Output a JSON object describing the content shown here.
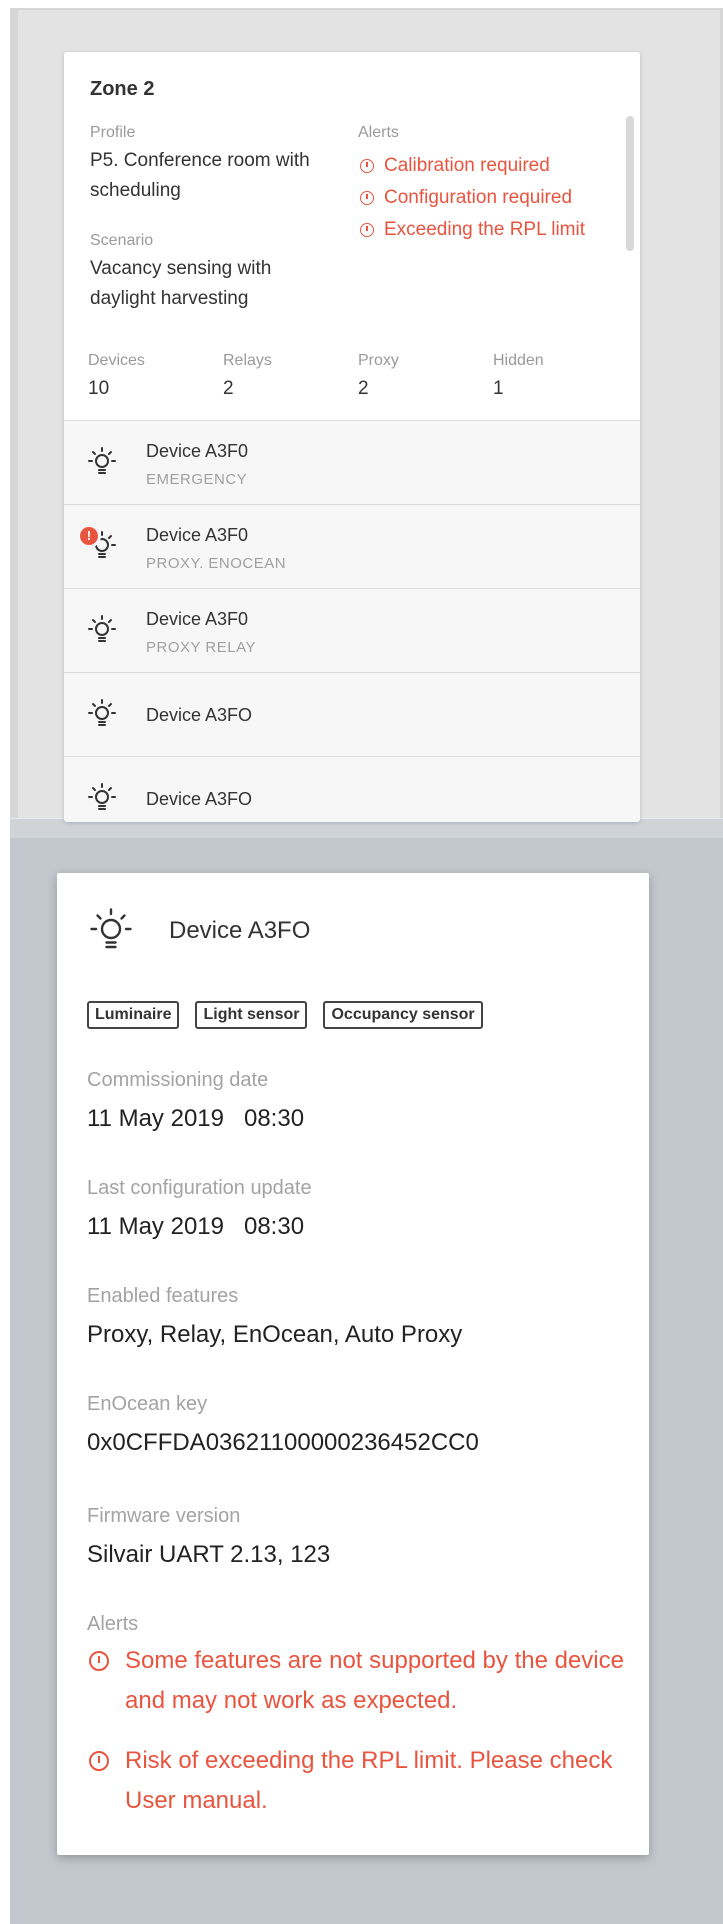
{
  "zone": {
    "title": "Zone 2",
    "profile_label": "Profile",
    "profile_value": "P5. Conference room with scheduling",
    "scenario_label": "Scenario",
    "scenario_value": "Vacancy sensing with daylight harvesting",
    "alerts_label": "Alerts",
    "alerts": [
      "Calibration required",
      "Configuration required",
      "Exceeding the RPL limit"
    ],
    "stats": [
      {
        "label": "Devices",
        "value": "10"
      },
      {
        "label": "Relays",
        "value": "2"
      },
      {
        "label": "Proxy",
        "value": "2"
      },
      {
        "label": "Hidden",
        "value": "1"
      }
    ]
  },
  "devices": [
    {
      "name": "Device A3F0",
      "sub": "EMERGENCY",
      "error": false
    },
    {
      "name": "Device A3F0",
      "sub": "PROXY. ENOCEAN",
      "error": true
    },
    {
      "name": "Device A3F0",
      "sub": "PROXY  RELAY",
      "error": false
    },
    {
      "name": "Device A3FO",
      "sub": "",
      "error": false
    },
    {
      "name": "Device A3FO",
      "sub": "",
      "error": false
    }
  ],
  "detail": {
    "title": "Device A3FO",
    "tags": [
      "Luminaire",
      "Light sensor",
      "Occupancy sensor"
    ],
    "commissioning_label": "Commissioning date",
    "commissioning_value": "11 May 2019   08:30",
    "last_config_label": "Last configuration update",
    "last_config_value": "11 May 2019   08:30",
    "features_label": "Enabled features",
    "features_value": "Proxy, Relay, EnOcean, Auto Proxy",
    "enocean_label": "EnOcean key",
    "enocean_value": "0x0CFFDA03621100000236452CC0",
    "firmware_label": "Firmware version",
    "firmware_value": "Silvair UART 2.13, 123",
    "alerts_label": "Alerts",
    "alerts": [
      "Some features are not supported by the device and may not work as expected.",
      "Risk of exceeding the RPL limit. Please check User manual."
    ]
  },
  "colors": {
    "alert": "#e9543f",
    "background": "#c3c8ce",
    "card": "#ffffff"
  }
}
